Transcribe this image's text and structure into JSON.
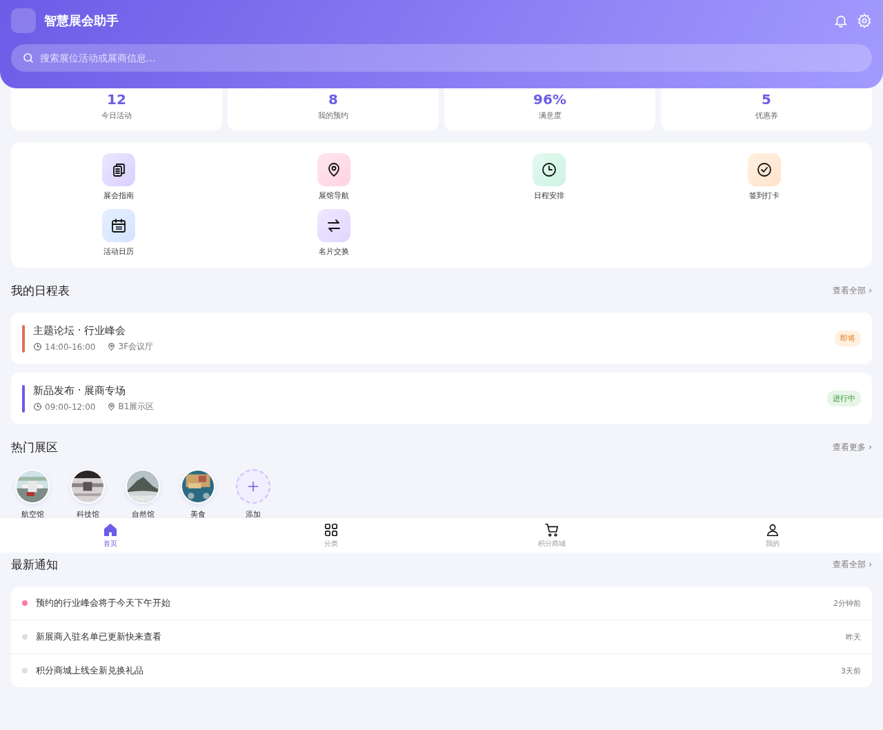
{
  "header": {
    "title": "智慧展会助手",
    "search": {
      "placeholder": "搜索展位活动或展商信息..."
    }
  },
  "stats": [
    {
      "value": "12",
      "label": "今日活动"
    },
    {
      "value": "8",
      "label": "我的预约"
    },
    {
      "value": "96%",
      "label": "满意度"
    },
    {
      "value": "5",
      "label": "优惠券"
    }
  ],
  "quick_actions": [
    {
      "kind": "clipboard",
      "label": "展会指南"
    },
    {
      "kind": "pin",
      "label": "展馆导航"
    },
    {
      "kind": "clock",
      "label": "日程安排"
    },
    {
      "kind": "check",
      "label": "签到打卡"
    },
    {
      "kind": "calendar",
      "label": "活动日历"
    },
    {
      "kind": "swap",
      "label": "名片交换"
    }
  ],
  "schedule": {
    "title": "我的日程表",
    "more": "查看全部 ›",
    "items": [
      {
        "title": "主题论坛 · 行业峰会",
        "time": "14:00-16:00",
        "place": "3F会议厅",
        "badge": "即将",
        "kind": "upcoming"
      },
      {
        "title": "新品发布 · 展商专场",
        "time": "09:00-12:00",
        "place": "B1展示区",
        "badge": "进行中",
        "kind": "ongoing"
      }
    ]
  },
  "zones": {
    "title": "热门展区",
    "more": "查看更多 ›",
    "items": [
      {
        "kind": "picture",
        "label": "航空馆"
      },
      {
        "kind": "picture",
        "label": "科技馆"
      },
      {
        "kind": "picture",
        "label": "自然馆"
      },
      {
        "kind": "picture",
        "label": "美食"
      },
      {
        "kind": "add",
        "label": "添加"
      }
    ]
  },
  "notices": {
    "title": "最新通知",
    "more": "查看全部 ›",
    "items": [
      {
        "text": "预约的行业峰会将于今天下午开始",
        "time": "2分钟前",
        "unread": true
      },
      {
        "text": "新展商入驻名单已更新快来查看",
        "time": "昨天",
        "unread": false
      },
      {
        "text": "积分商城上线全新兑换礼品",
        "time": "3天前",
        "unread": false
      }
    ]
  },
  "tab_bar": [
    {
      "kind": "home",
      "label": "首页",
      "selected": true
    },
    {
      "kind": "grid",
      "label": "分类",
      "selected": false
    },
    {
      "kind": "cart",
      "label": "积分商城",
      "selected": false
    },
    {
      "kind": "person",
      "label": "我的",
      "selected": false
    }
  ]
}
